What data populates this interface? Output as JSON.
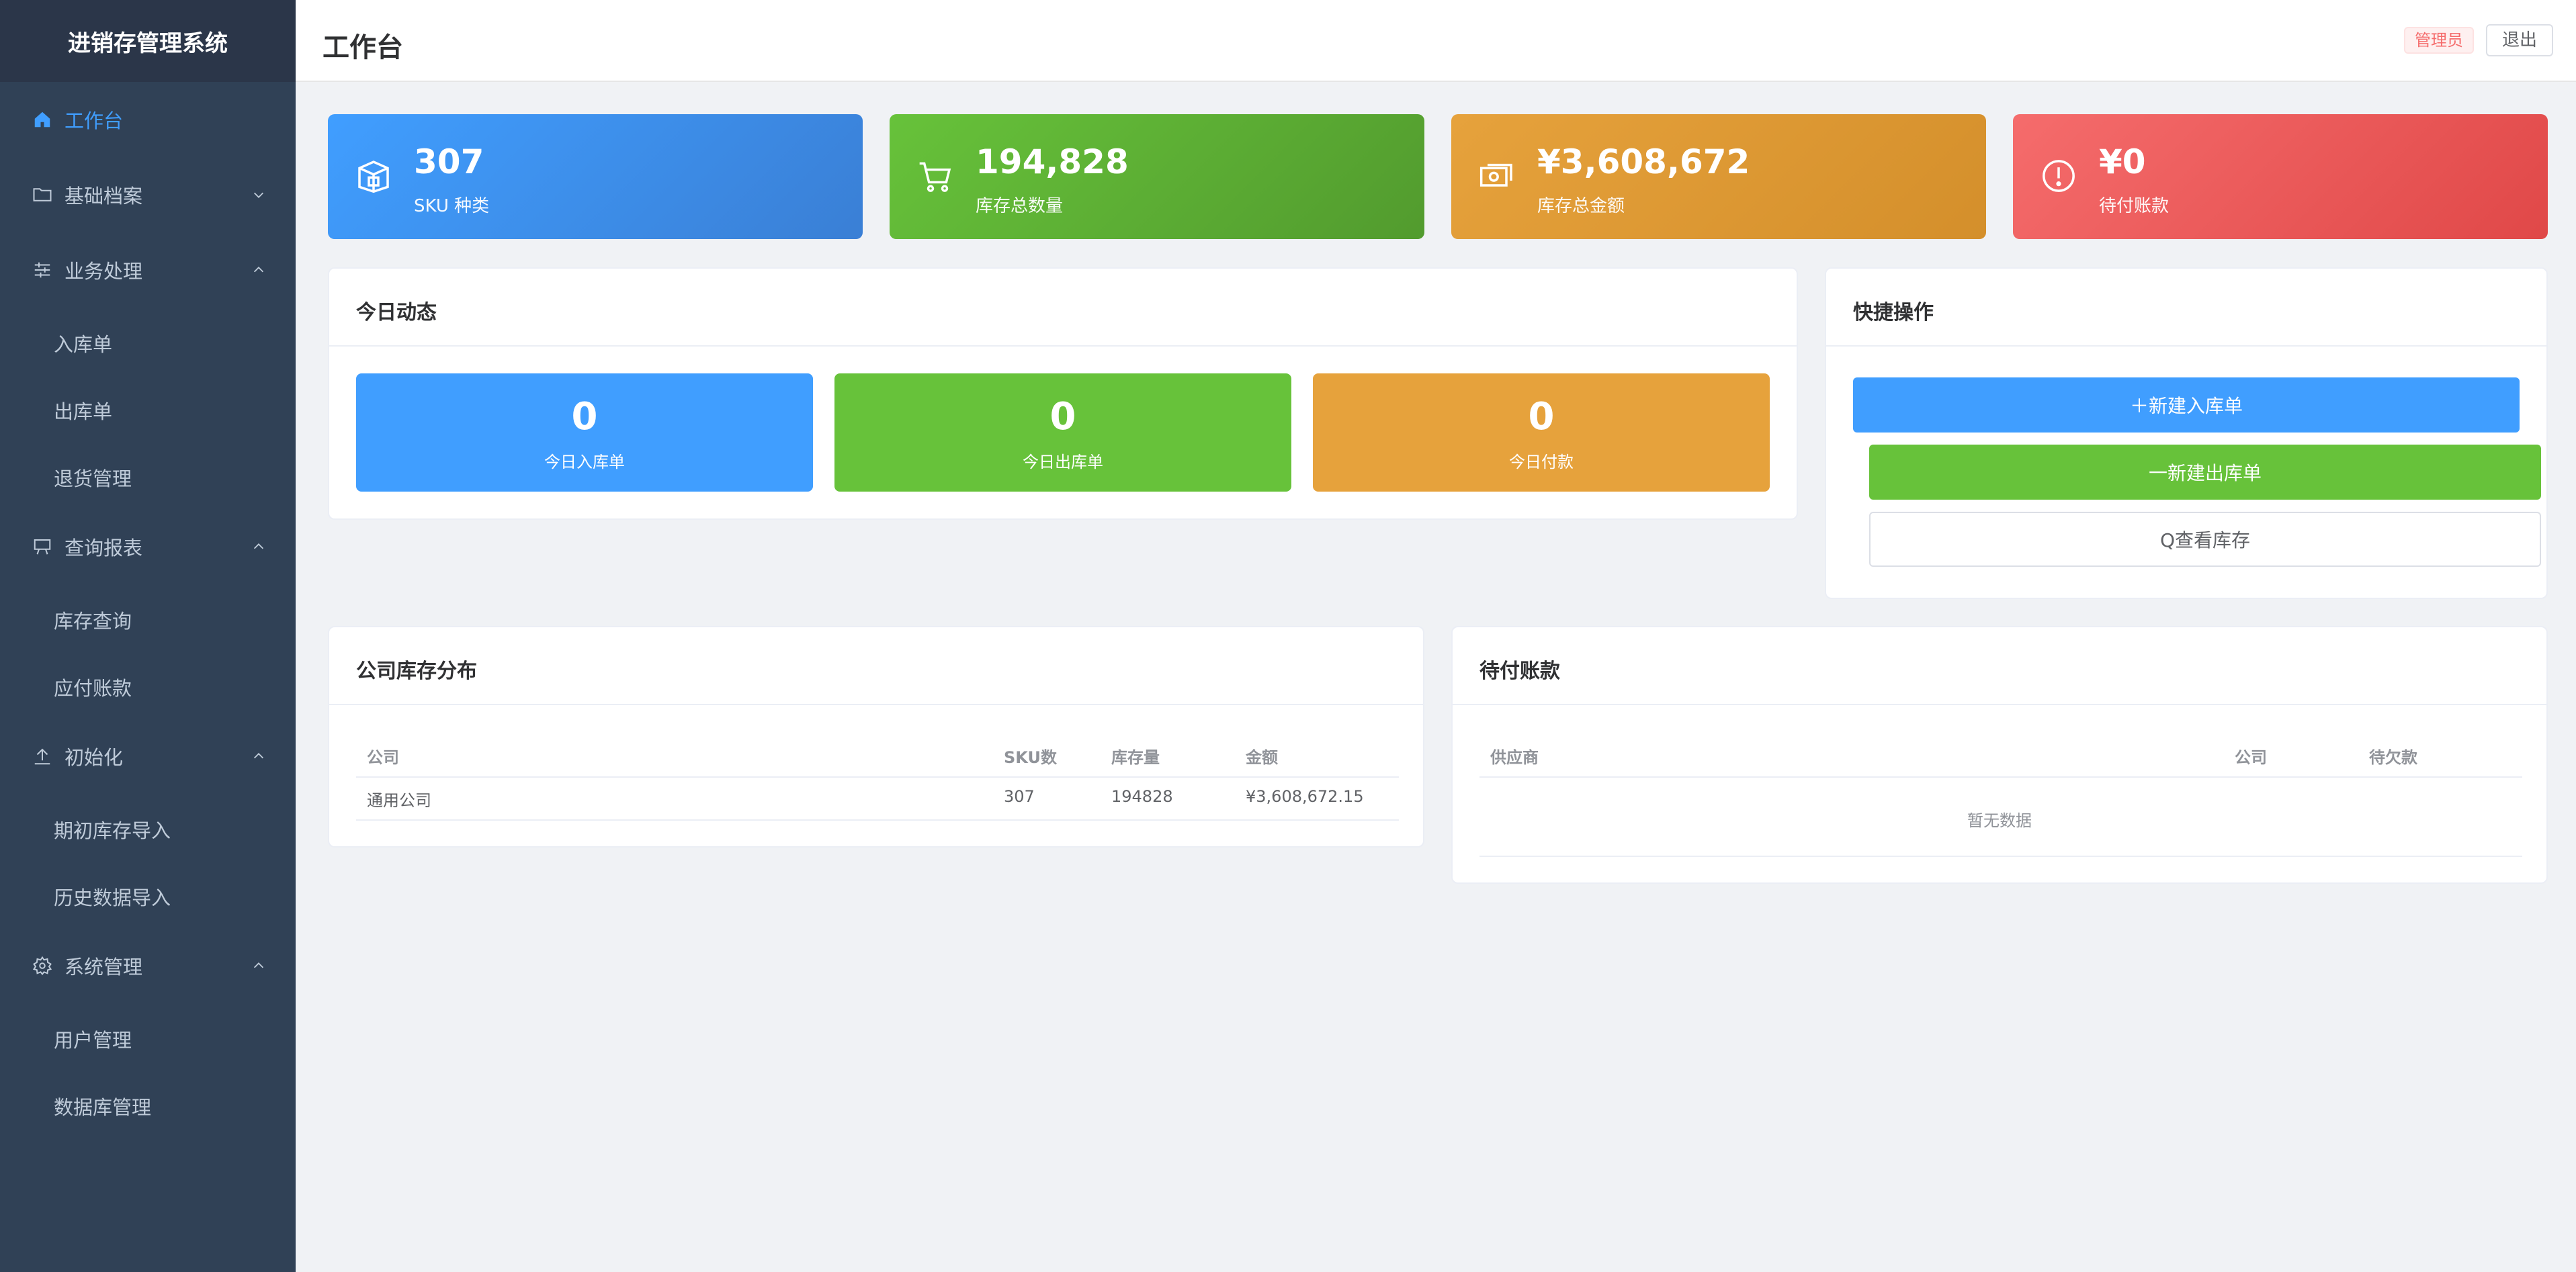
{
  "app": {
    "title": "进销存管理系统"
  },
  "sidebar": {
    "items": [
      {
        "label": "工作台"
      },
      {
        "label": "基础档案"
      },
      {
        "label": "业务处理",
        "children": [
          "入库单",
          "出库单",
          "退货管理"
        ]
      },
      {
        "label": "查询报表",
        "children": [
          "库存查询",
          "应付账款"
        ]
      },
      {
        "label": "初始化",
        "children": [
          "期初库存导入",
          "历史数据导入"
        ]
      },
      {
        "label": "系统管理",
        "children": [
          "用户管理",
          "数据库管理"
        ]
      }
    ]
  },
  "header": {
    "title": "工作台",
    "role": "管理员",
    "logout": "退出"
  },
  "stats": [
    {
      "value": "307",
      "label": "SKU 种类",
      "color": "#409eff"
    },
    {
      "value": "194,828",
      "label": "库存总数量",
      "color": "#67c23a"
    },
    {
      "value": "¥3,608,672",
      "label": "库存总金额",
      "color": "#e6a23c"
    },
    {
      "value": "¥0",
      "label": "待付账款",
      "color": "#f56c6c"
    }
  ],
  "today": {
    "title": "今日动态",
    "items": [
      {
        "value": "0",
        "label": "今日入库单",
        "color": "#409eff"
      },
      {
        "value": "0",
        "label": "今日出库单",
        "color": "#67c23a"
      },
      {
        "value": "0",
        "label": "今日付款",
        "color": "#e6a23c"
      }
    ]
  },
  "quick": {
    "title": "快捷操作",
    "new_inbound": "＋新建入库单",
    "new_outbound": "一新建出库单",
    "view_stock": "Q查看库存"
  },
  "distribution": {
    "title": "公司库存分布",
    "columns": [
      "公司",
      "SKU数",
      "库存量",
      "金额"
    ],
    "rows": [
      [
        "通用公司",
        "307",
        "194828",
        "¥3,608,672.15"
      ]
    ]
  },
  "payables": {
    "title": "待付账款",
    "columns": [
      "供应商",
      "公司",
      "待欠款"
    ],
    "empty": "暂无数据"
  }
}
